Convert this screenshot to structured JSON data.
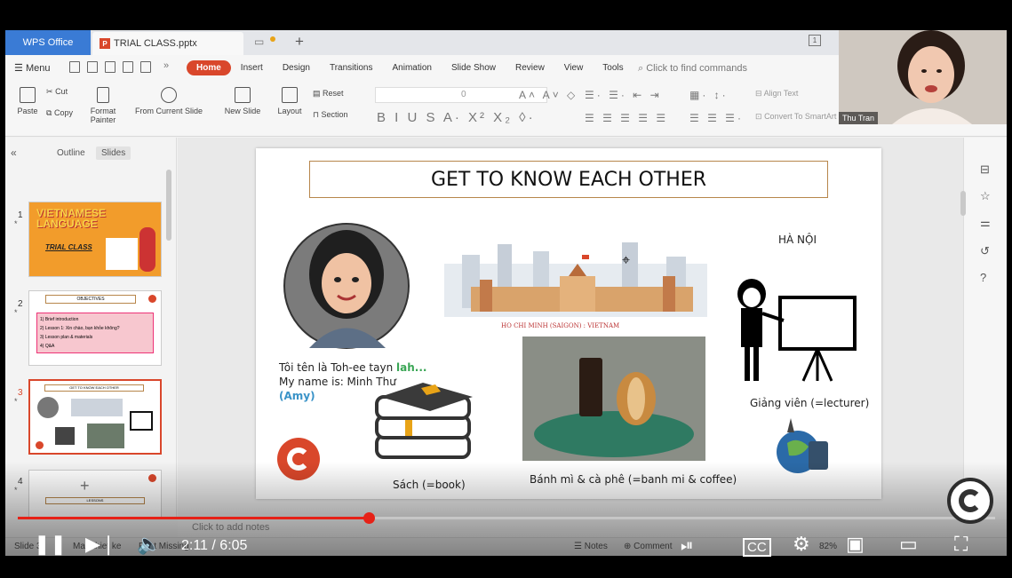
{
  "titlebar": {
    "app_tab": "WPS Office",
    "doc_tab": "TRIAL CLASS.pptx",
    "page_indicator": "1"
  },
  "menu": {
    "menu_label": "Menu",
    "tabs": [
      "Home",
      "Insert",
      "Design",
      "Transitions",
      "Animation",
      "Slide Show",
      "Review",
      "View",
      "Tools"
    ],
    "active_tab": "Home",
    "find_placeholder": "Click to find commands"
  },
  "ribbon": {
    "paste": "Paste",
    "cut": "Cut",
    "copy": "Copy",
    "format_painter": "Format Painter",
    "from_current_slide": "From Current Slide",
    "new_slide": "New Slide",
    "layout": "Layout",
    "reset": "Reset",
    "section": "Section",
    "font_size": "0",
    "align_text": "Align Text",
    "convert": "Convert To SmartArt"
  },
  "webcam": {
    "name": "Thu Tran"
  },
  "left_panel": {
    "tabs": [
      "Outline",
      "Slides"
    ],
    "active_tab": "Slides",
    "thumbs": [
      {
        "num": "1",
        "title": "VIETNAMESE LANGUAGE",
        "subtitle": "TRIAL CLASS"
      },
      {
        "num": "2",
        "title": "OBJECTIVES",
        "items": [
          "1) Brief introduction",
          "2) Lesson 1: Xin chào, bạn khỏe không?",
          "3) Lesson plan & materials",
          "4) Q&A"
        ]
      },
      {
        "num": "3",
        "title": "GET TO KNOW EACH OTHER"
      },
      {
        "num": "4",
        "title": "LESSONS"
      }
    ]
  },
  "slide": {
    "title": "GET TO KNOW EACH OTHER",
    "intro_line1_prefix": "Tôi tên là Toh-ee tayn ",
    "intro_line1_highlight": "lah...",
    "intro_line2": "My name is: Minh Thư",
    "intro_line3": "(Amy)",
    "city_caption": "HO CHI MINH (SAIGON) : VIETNAM",
    "hanoi": "HÀ NỘI",
    "lecturer": "Giảng viên (=lecturer)",
    "book": "Sách (=book)",
    "food": "Bánh mì & cà phê (=banh mi & coffee)"
  },
  "notes": {
    "placeholder": "Click to add notes"
  },
  "status": {
    "slide_info": "Slide 3",
    "theme": "Mau thiet ke",
    "font_missing": "Font Missing",
    "notes": "Notes",
    "comment": "Comment",
    "zoom": "82%"
  },
  "video": {
    "current_time": "2:11",
    "duration": "6:05",
    "time_display": "2:11 / 6:05",
    "progress": 0.359
  },
  "colors": {
    "wps_blue": "#3a7bd5",
    "accent_red": "#d9472b",
    "yt_red": "#e62117",
    "green_text": "#3aa655",
    "blue_text": "#3a93c8"
  }
}
